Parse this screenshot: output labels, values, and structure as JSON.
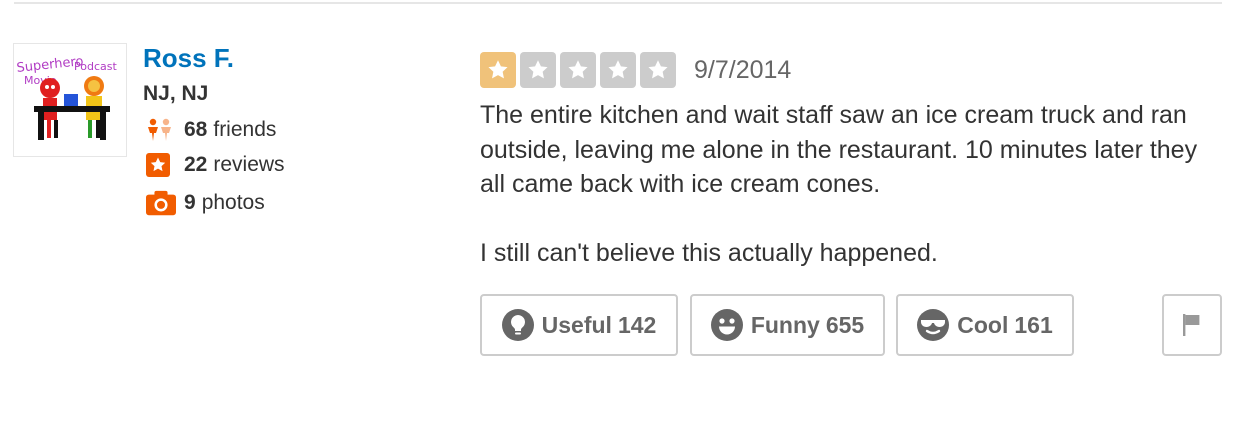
{
  "user": {
    "avatar_text": "Superhero Movie Podcast",
    "name": "Ross F.",
    "location": "NJ, NJ",
    "stats": {
      "friends_count": "68",
      "friends_label": "friends",
      "reviews_count": "22",
      "reviews_label": "reviews",
      "photos_count": "9",
      "photos_label": "photos"
    }
  },
  "review": {
    "rating": 1,
    "rating_max": 5,
    "date": "9/7/2014",
    "paragraphs": [
      "The entire kitchen and wait staff saw an ice cream truck and ran outside, leaving me alone in the restaurant. 10 minutes later they all came back with ice cream cones.",
      "I still can't believe this actually happened."
    ]
  },
  "votes": {
    "useful_label": "Useful",
    "useful_count": "142",
    "funny_label": "Funny",
    "funny_count": "655",
    "cool_label": "Cool",
    "cool_count": "161"
  },
  "icons": {
    "friends": "friends-icon",
    "reviews": "star-badge-icon",
    "photos": "camera-icon",
    "useful": "lightbulb-icon",
    "funny": "smiley-icon",
    "cool": "sunglasses-face-icon",
    "flag": "flag-icon"
  },
  "colors": {
    "user_link": "#0073bb",
    "stat_icon": "#f15c00",
    "star_filled": "#f0c27a",
    "star_empty": "#cccccc",
    "button_border": "#cccccc",
    "button_text": "#666666"
  }
}
